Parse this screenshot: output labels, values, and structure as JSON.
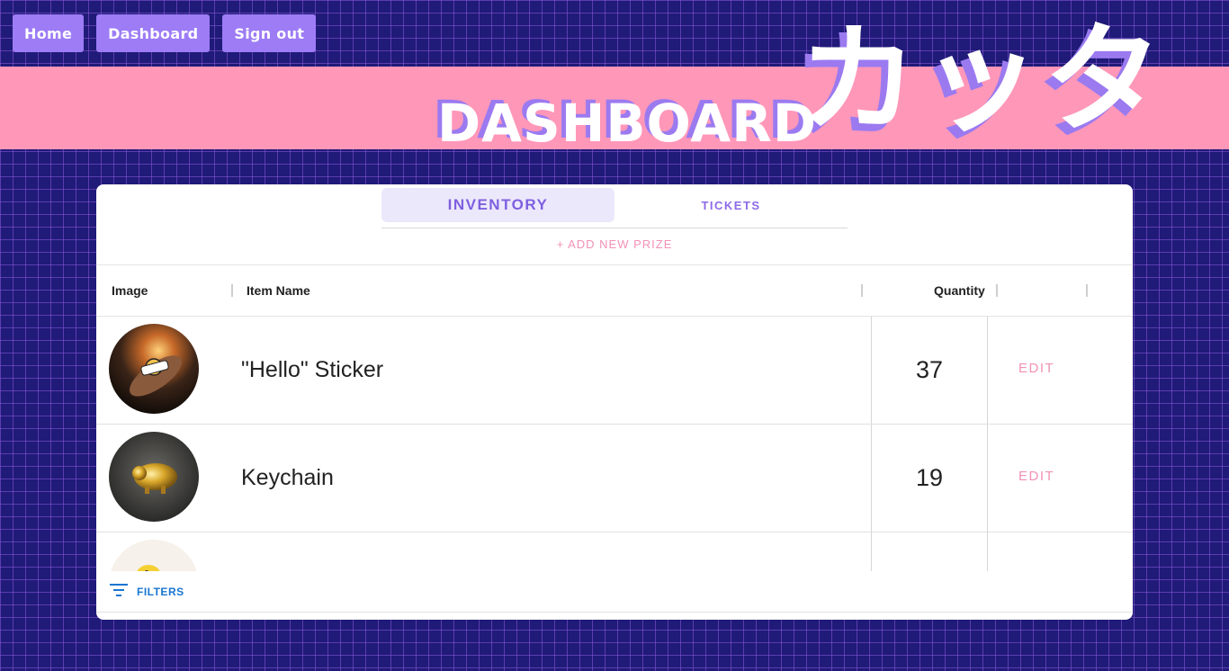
{
  "nav": {
    "home": "Home",
    "dashboard": "Dashboard",
    "sign_out": "Sign out"
  },
  "hero": {
    "title": "DASHBOARD",
    "kana": "カッタ"
  },
  "colors": {
    "background": "#201a78",
    "banner": "#ff97b9",
    "accent": "#9d7cf5",
    "pink": "#f191b6",
    "filters_blue": "#1976d2"
  },
  "tabs": [
    {
      "label": "INVENTORY",
      "active": true
    },
    {
      "label": "TICKETS",
      "active": false
    }
  ],
  "add_prize": "+ ADD NEW PRIZE",
  "table": {
    "columns": {
      "image": "Image",
      "item_name": "Item Name",
      "quantity": "Quantity"
    },
    "rows": [
      {
        "name": "\"Hello\" Sticker",
        "quantity": "37",
        "action": "EDIT",
        "image_icon": "sticker-photo"
      },
      {
        "name": "Keychain",
        "quantity": "19",
        "action": "EDIT",
        "image_icon": "pig-keychain-photo"
      },
      {
        "name": "",
        "quantity": "",
        "action": "",
        "image_icon": "rubber-duck-photo"
      }
    ]
  },
  "footer": {
    "filters_label": "FILTERS"
  }
}
